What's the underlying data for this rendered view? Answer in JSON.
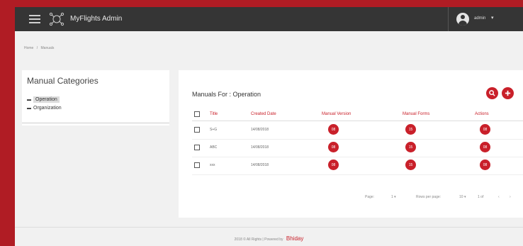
{
  "header": {
    "app_title": "MyFlights Admin",
    "user_name": "admin",
    "user_chevron": "▾"
  },
  "breadcrumb": {
    "items": [
      "Home",
      "/",
      "Manuals"
    ]
  },
  "categories": {
    "title": "Manual Categories",
    "items": [
      {
        "label": "Operation",
        "active": true
      },
      {
        "label": "Organization",
        "active": false
      }
    ]
  },
  "manuals": {
    "title": "Manuals For : Operation",
    "search_icon": "search-icon",
    "add_icon": "plus-icon",
    "columns": [
      "Title",
      "Created Date",
      "Manual Version",
      "Manual Forms",
      "Actions"
    ],
    "rows": [
      {
        "title": "S+G",
        "created": "14/08/2018",
        "version_btn": "08",
        "forms_btn": "15",
        "action_btn": "08"
      },
      {
        "title": "ABC",
        "created": "14/08/2018",
        "version_btn": "08",
        "forms_btn": "15",
        "action_btn": "08"
      },
      {
        "title": "xxx",
        "created": "14/08/2018",
        "version_btn": "08",
        "forms_btn": "15",
        "action_btn": "08"
      }
    ],
    "pager": {
      "page_label": "Page:",
      "page_value": "1 ▾",
      "rows_label": "Rows per page:",
      "rows_value": "10 ▾",
      "range": "1 of",
      "prev": "‹",
      "next": "›"
    }
  },
  "footer": {
    "text": "2018 © All Rights | Powered by",
    "brand": "Bhiday"
  },
  "colors": {
    "brand_red": "#c9202a",
    "topbar": "#353535",
    "background": "#f1f1f1"
  }
}
